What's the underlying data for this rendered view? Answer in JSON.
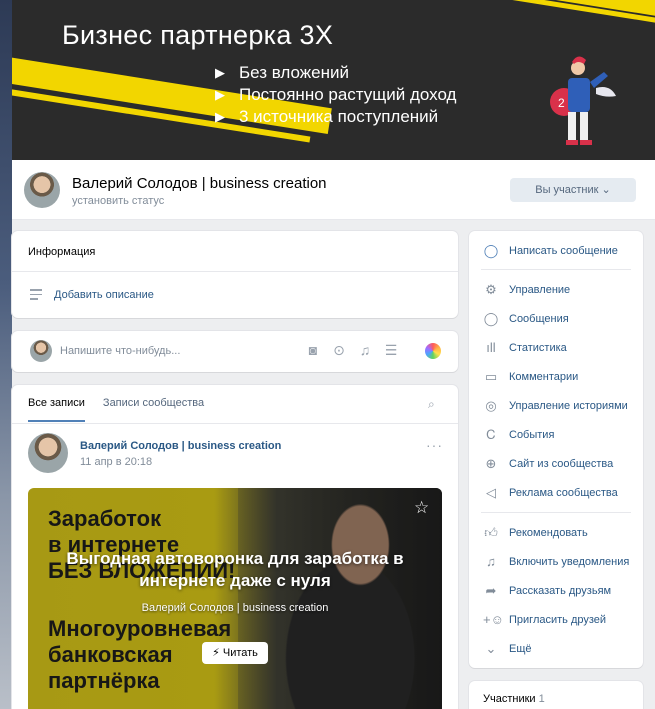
{
  "cover": {
    "title": "Бизнес партнерка 3Х",
    "bullets": [
      "Без вложений",
      "Постоянно растущий доход",
      "3 источника поступлений"
    ]
  },
  "header": {
    "name": "Валерий Солодов | business creation",
    "status": "установить статус",
    "member_button": "Вы участник ⌄"
  },
  "info": {
    "heading": "Информация",
    "add_description": "Добавить описание"
  },
  "composer": {
    "placeholder": "Напишите что-нибудь...",
    "tools": [
      "camera-icon",
      "video-icon",
      "music-icon",
      "text-icon"
    ]
  },
  "feed": {
    "tabs": [
      "Все записи",
      "Записи сообщества"
    ],
    "post": {
      "author": "Валерий Солодов | business creation",
      "date": "11 апр в 20:18",
      "bg_text_top": "Заработок\nв интернете\nБЕЗ ВЛОЖЕНИЙ!",
      "bg_text_bottom": "Многоуровневая\nбанковская\nпартнёрка",
      "headline": "Выгодная автоворонка для заработка в интернете даже с нуля",
      "source": "Валерий Солодов | business creation",
      "read_button": "⚡ Читать"
    }
  },
  "actions": {
    "primary": "Написать сообщение",
    "admin": [
      "Управление",
      "Сообщения",
      "Статистика",
      "Комментарии",
      "Управление историями",
      "События",
      "Сайт из сообщества",
      "Реклама сообщества"
    ],
    "social": [
      "Рекомендовать",
      "Включить уведомления",
      "Рассказать друзьям",
      "Пригласить друзей",
      "Ещё"
    ]
  },
  "members": {
    "label": "Участники",
    "count": "1"
  }
}
